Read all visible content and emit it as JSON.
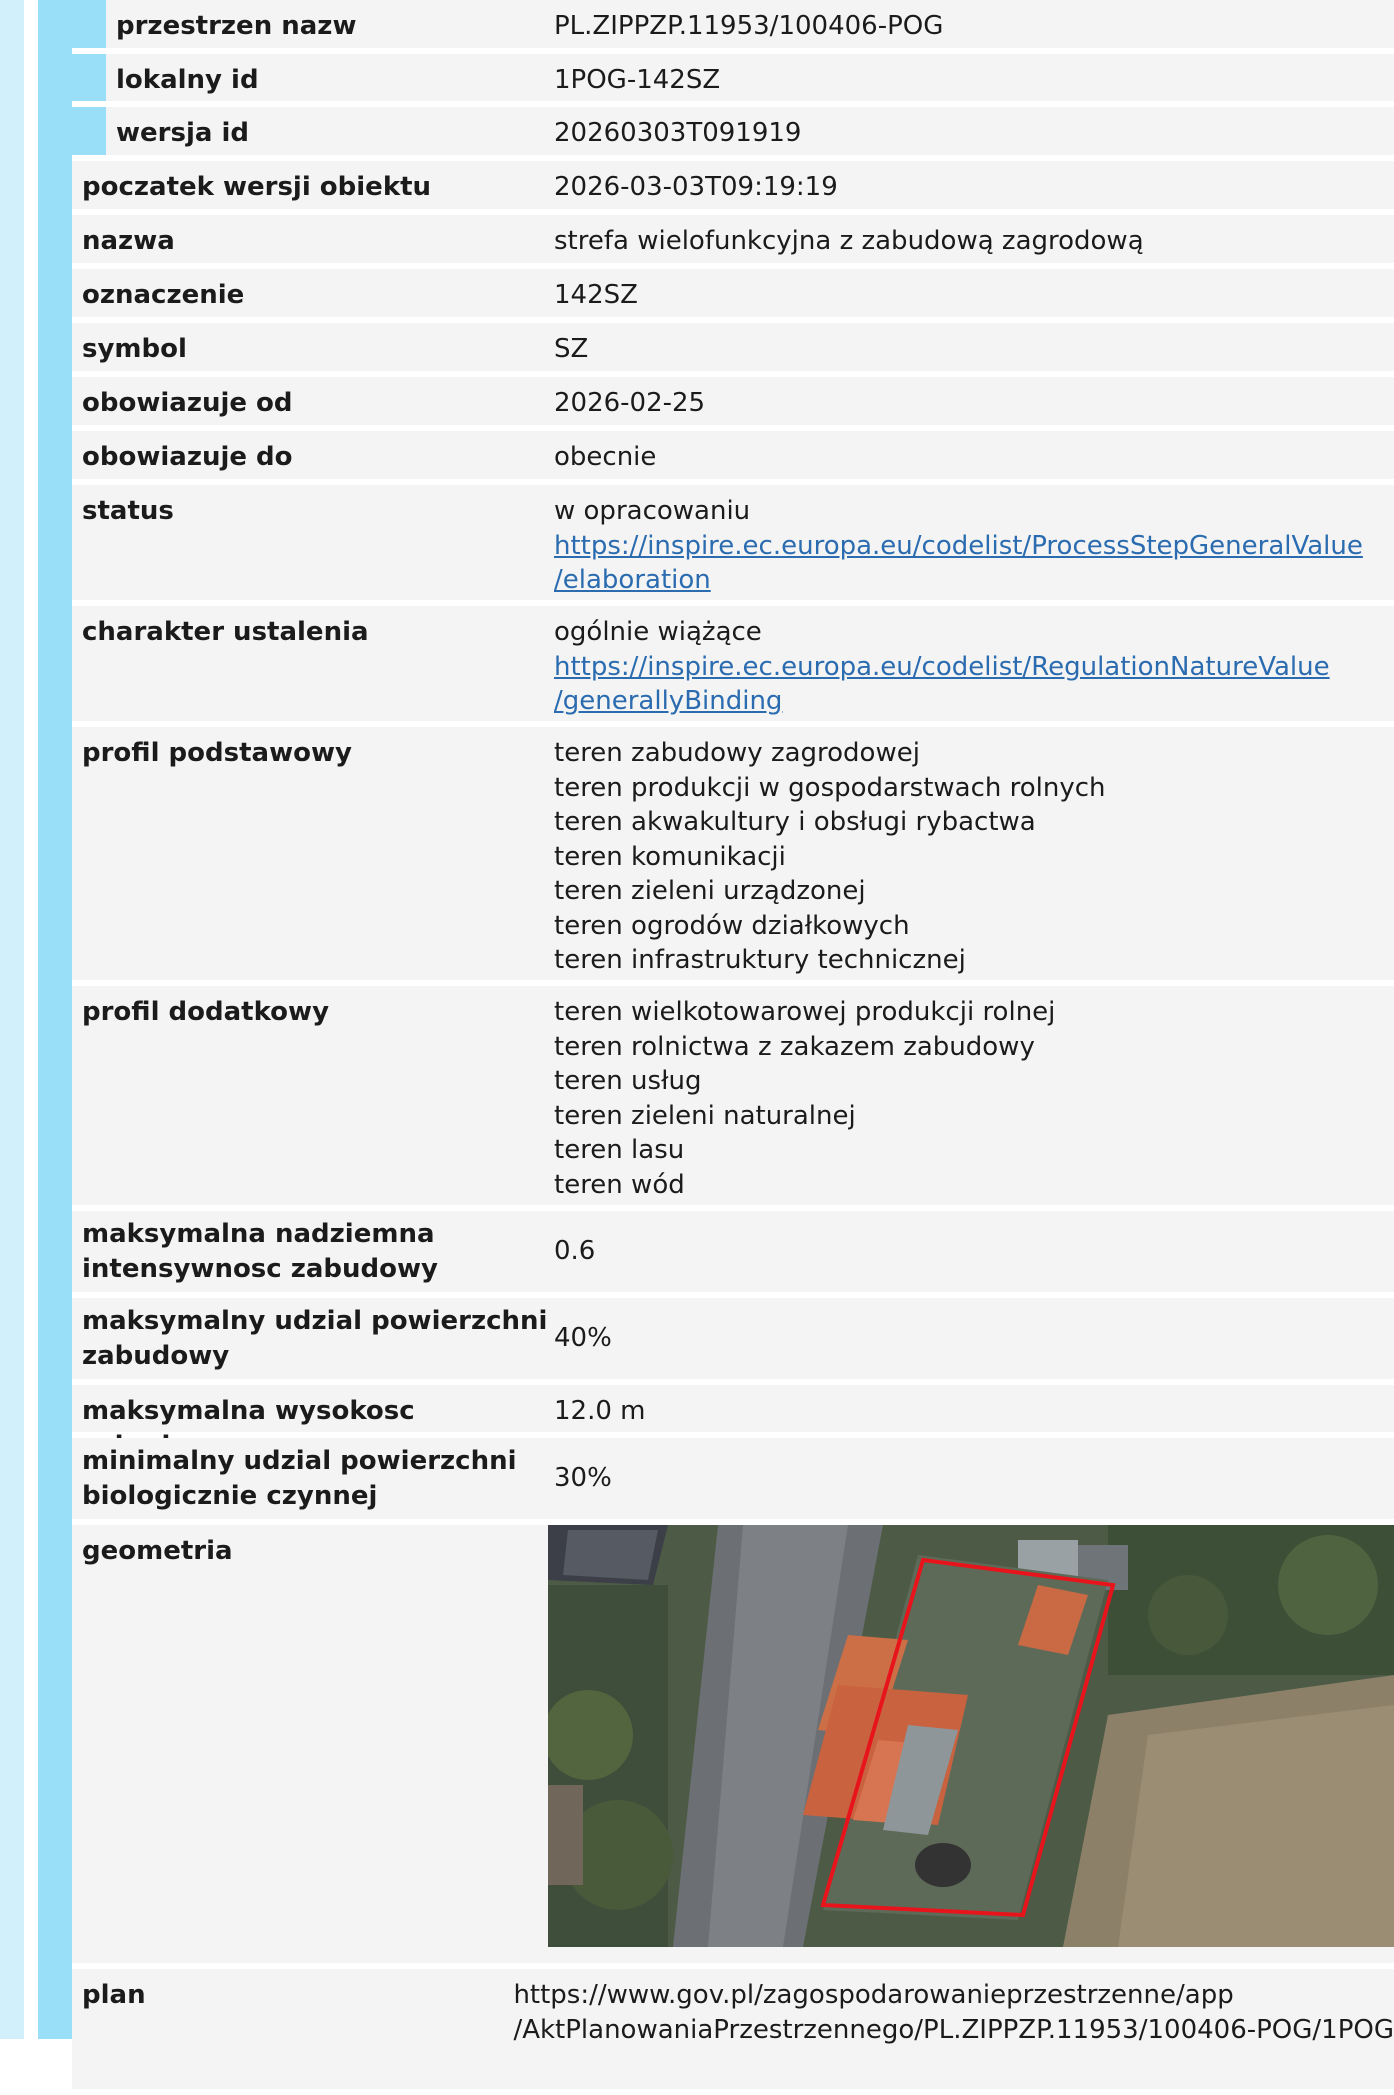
{
  "rows": {
    "przestrzen_nazw": {
      "key": "przestrzen nazw",
      "value": "PL.ZIPPZP.11953/100406-POG"
    },
    "lokalny_id": {
      "key": "lokalny id",
      "value": "1POG-142SZ"
    },
    "wersja_id": {
      "key": "wersja id",
      "value": "20260303T091919"
    },
    "poczatek": {
      "key": "poczatek wersji obiektu",
      "value": "2026-03-03T09:19:19"
    },
    "nazwa": {
      "key": "nazwa",
      "value": "strefa wielofunkcyjna z zabudową zagrodową"
    },
    "oznaczenie": {
      "key": "oznaczenie",
      "value": "142SZ"
    },
    "symbol": {
      "key": "symbol",
      "value": "SZ"
    },
    "obow_od": {
      "key": "obowiazuje od",
      "value": "2026-02-25"
    },
    "obow_do": {
      "key": "obowiazuje do",
      "value": "obecnie"
    },
    "status": {
      "key": "status",
      "value": "w opracowaniu",
      "link_line1": "https://inspire.ec.europa.eu/codelist/ProcessStepGeneralValue",
      "link_line2": "/elaboration"
    },
    "charakter": {
      "key": "charakter ustalenia",
      "value": "ogólnie wiążące",
      "link_line1": "https://inspire.ec.europa.eu/codelist/RegulationNatureValue",
      "link_line2": "/generallyBinding"
    },
    "profil_podstawowy": {
      "key": "profil podstawowy",
      "values": [
        "teren zabudowy zagrodowej",
        "teren produkcji w gospodarstwach rolnych",
        "teren akwakultury i obsługi rybactwa",
        "teren komunikacji",
        "teren zieleni urządzonej",
        "teren ogrodów działkowych",
        "teren infrastruktury technicznej"
      ]
    },
    "profil_dodatkowy": {
      "key": "profil dodatkowy",
      "values": [
        "teren wielkotowarowej produkcji rolnej",
        "teren rolnictwa z zakazem zabudowy",
        "teren usług",
        "teren zieleni naturalnej",
        "teren lasu",
        "teren wód"
      ]
    },
    "max_intensywnosc": {
      "key_line1": "maksymalna nadziemna",
      "key_line2": "intensywnosc zabudowy",
      "value": "0.6"
    },
    "max_udzial": {
      "key_line1": "maksymalny udzial powierzchni",
      "key_line2": "zabudowy",
      "value": "40%"
    },
    "max_wysokosc": {
      "key": "maksymalna wysokosc zabudowy",
      "value": "12.0 m"
    },
    "min_udzial_bio": {
      "key_line1": "minimalny udzial powierzchni",
      "key_line2": "biologicznie czynnej",
      "value": "30%"
    },
    "geometria": {
      "key": "geometria"
    },
    "plan": {
      "key": "plan",
      "line1": "https://www.gov.pl/zagospodarowanieprzestrzenne/app",
      "line2": "/AktPlanowaniaPrzestrzennego/PL.ZIPPZP.11953/100406-POG/1POG"
    }
  },
  "colors": {
    "outer_bar": "#d2f0fb",
    "inner_bar": "#99dff7",
    "row_bg": "#f4f4f4",
    "link": "#2b6cb0",
    "polygon": "#e8141c"
  }
}
